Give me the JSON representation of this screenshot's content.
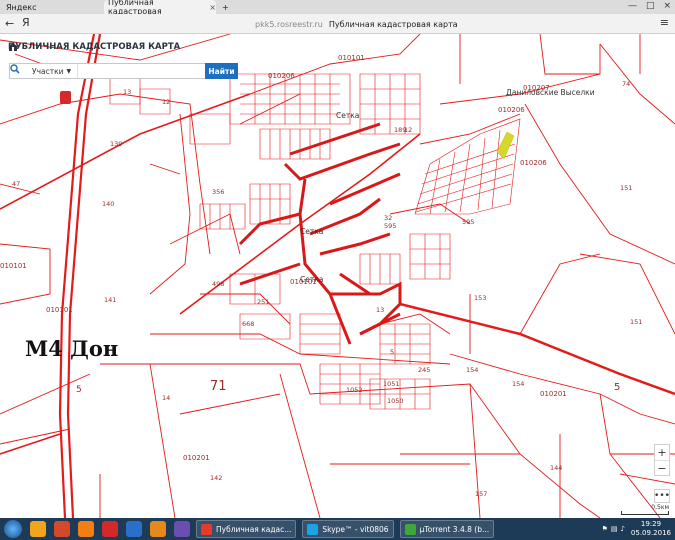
{
  "browser": {
    "tabs": [
      {
        "label": "Яндекс"
      },
      {
        "label": "Публичная кадастровая"
      }
    ],
    "url_domain": "pkk5.rosreestr.ru",
    "page_title": "Публичная кадастровая карта",
    "back_icon": "back-arrow-icon",
    "menu_icon": "hamburger-icon"
  },
  "site": {
    "title": "ПУБЛИЧНАЯ КАДАСТРОВАЯ КАРТА",
    "search_type": "Участки",
    "search_placeholder": "",
    "search_button": "Найти"
  },
  "map": {
    "road_label": "М4 Дон",
    "places": [
      "Даниловские Выселки",
      "Сетка",
      "Сетка",
      "Сетка"
    ],
    "parcel_numbers": [
      "010101",
      "010206",
      "010207",
      "010206",
      "010206",
      "010201",
      "010101",
      "010101",
      "010201",
      "010101",
      "74",
      "13",
      "12",
      "139",
      "47",
      "140",
      "151",
      "141",
      "498",
      "251",
      "668",
      "71",
      "14",
      "5",
      "142",
      "153",
      "151",
      "5",
      "154",
      "154",
      "144",
      "157",
      "189",
      "12",
      "595",
      "595",
      "356",
      "32",
      "1052",
      "1051",
      "1050",
      "245",
      "13",
      "5"
    ],
    "scale_label": "0,5км",
    "zoom_in": "+",
    "zoom_out": "−",
    "more": "•••",
    "accent_color": "#e21b1b"
  },
  "taskbar": {
    "items": [
      {
        "label": "Публичная кадас..."
      },
      {
        "label": "Skype™ - vit0806"
      },
      {
        "label": "µTorrent 3.4.8 (b..."
      }
    ],
    "time": "19:29",
    "date": "05.09.2016"
  }
}
